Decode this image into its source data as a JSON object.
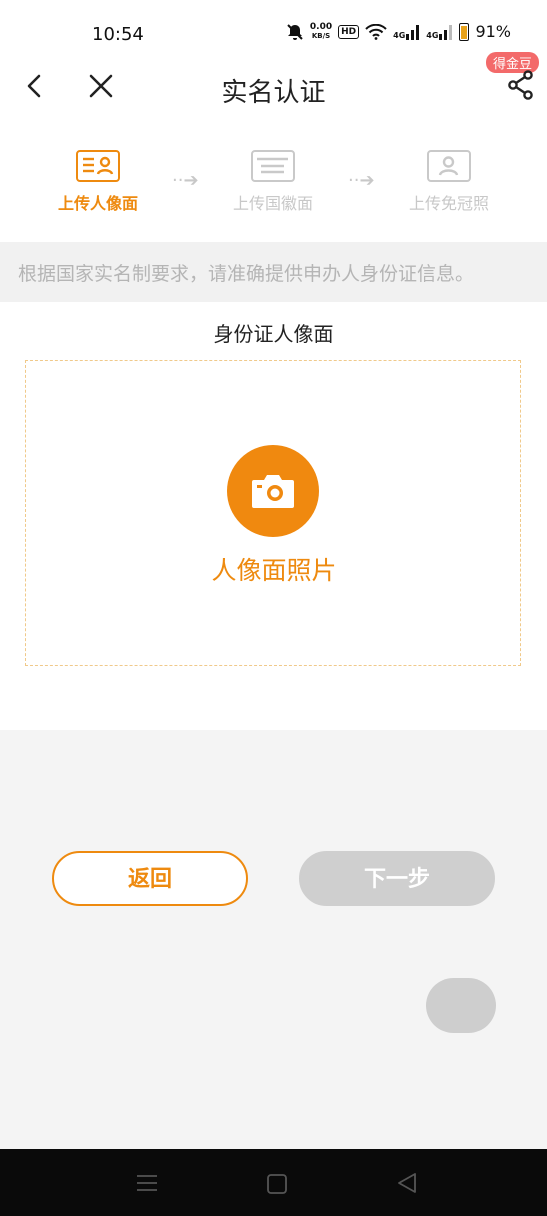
{
  "status_bar": {
    "time": "10:54",
    "net_speed_value": "0.00",
    "net_speed_unit": "KB/S",
    "hd_label": "HD",
    "signal1_label": "4G",
    "signal2_label": "4G",
    "battery_text": "91%"
  },
  "nav": {
    "title": "实名认证",
    "badge": "得金豆",
    "back_icon": "chevron-left-icon",
    "close_icon": "close-icon",
    "share_icon": "share-icon"
  },
  "steps": [
    {
      "label": "上传人像面",
      "active": true
    },
    {
      "label": "上传国徽面",
      "active": false
    },
    {
      "label": "上传免冠照",
      "active": false
    }
  ],
  "notice": "根据国家实名制要求，请准确提供申办人身份证信息。",
  "upload": {
    "title": "身份证人像面",
    "button_label": "人像面照片"
  },
  "buttons": {
    "back": "返回",
    "next": "下一步"
  },
  "colors": {
    "accent": "#ee8a0f",
    "disabled": "#cfcfcf",
    "badge": "#f36a6a"
  }
}
